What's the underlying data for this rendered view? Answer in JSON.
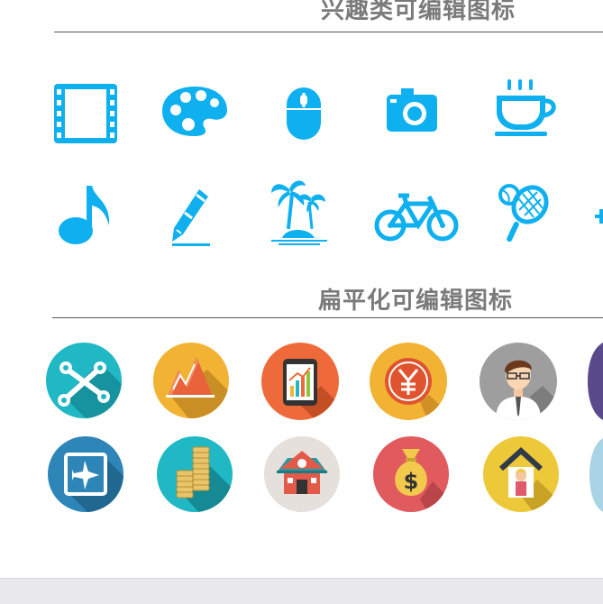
{
  "sections": {
    "interest_title": "兴趣类可编辑图标",
    "flat_title": "扁平化可编辑图标"
  },
  "colors": {
    "line_icon_blue": "#0fb0f0",
    "title_gray": "#7a7a7a"
  },
  "interest_icons": [
    "film-icon",
    "palette-icon",
    "mouse-icon",
    "camera-icon",
    "coffee-cup-icon",
    "music-note-icon",
    "pencil-icon",
    "palm-island-icon",
    "bicycle-icon",
    "tennis-racket-icon"
  ],
  "flat_icons": [
    "wrench-icon",
    "chart-mountain-icon",
    "tablet-chart-icon",
    "yen-coin-icon",
    "businessman-avatar-icon",
    "airplane-sign-icon",
    "coin-stack-icon",
    "house-icon",
    "money-bag-icon",
    "home-person-icon"
  ]
}
